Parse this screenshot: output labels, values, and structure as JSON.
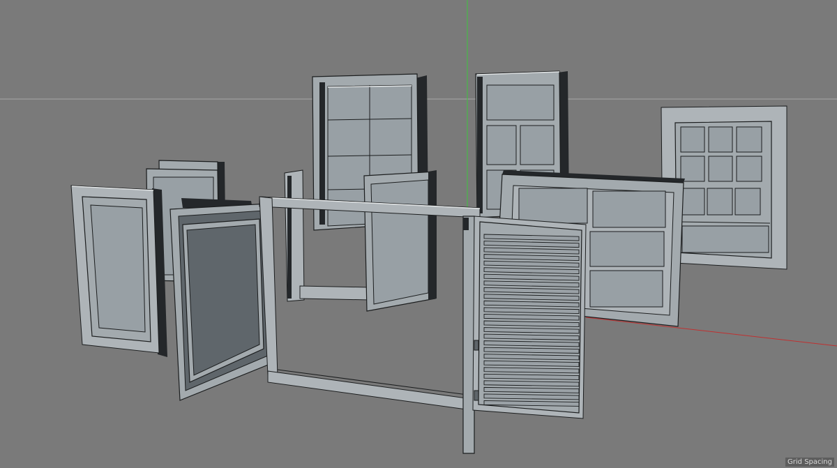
{
  "viewport": {
    "hud_label": "Grid Spacing"
  },
  "colors": {
    "background": "#7a7a7a",
    "horizon_line": "#a9a9a9",
    "y_axis": "#3ec43e",
    "x_axis": "#c03030",
    "model_fill": "#9ea6ab",
    "model_face_light": "#aab1b5",
    "model_face_dark": "#6a7176",
    "model_edge": "#1b1d1e",
    "model_edge_light": "#e8eaeb"
  },
  "scene": {
    "objects": [
      "casement-window-left",
      "small-window-back-left",
      "open-sash-left",
      "double-hung-window-tall",
      "open-casement-pair-center",
      "six-panel-door",
      "wide-panel-window",
      "nine-lite-window-right",
      "central-frame",
      "louvered-shutter"
    ]
  }
}
